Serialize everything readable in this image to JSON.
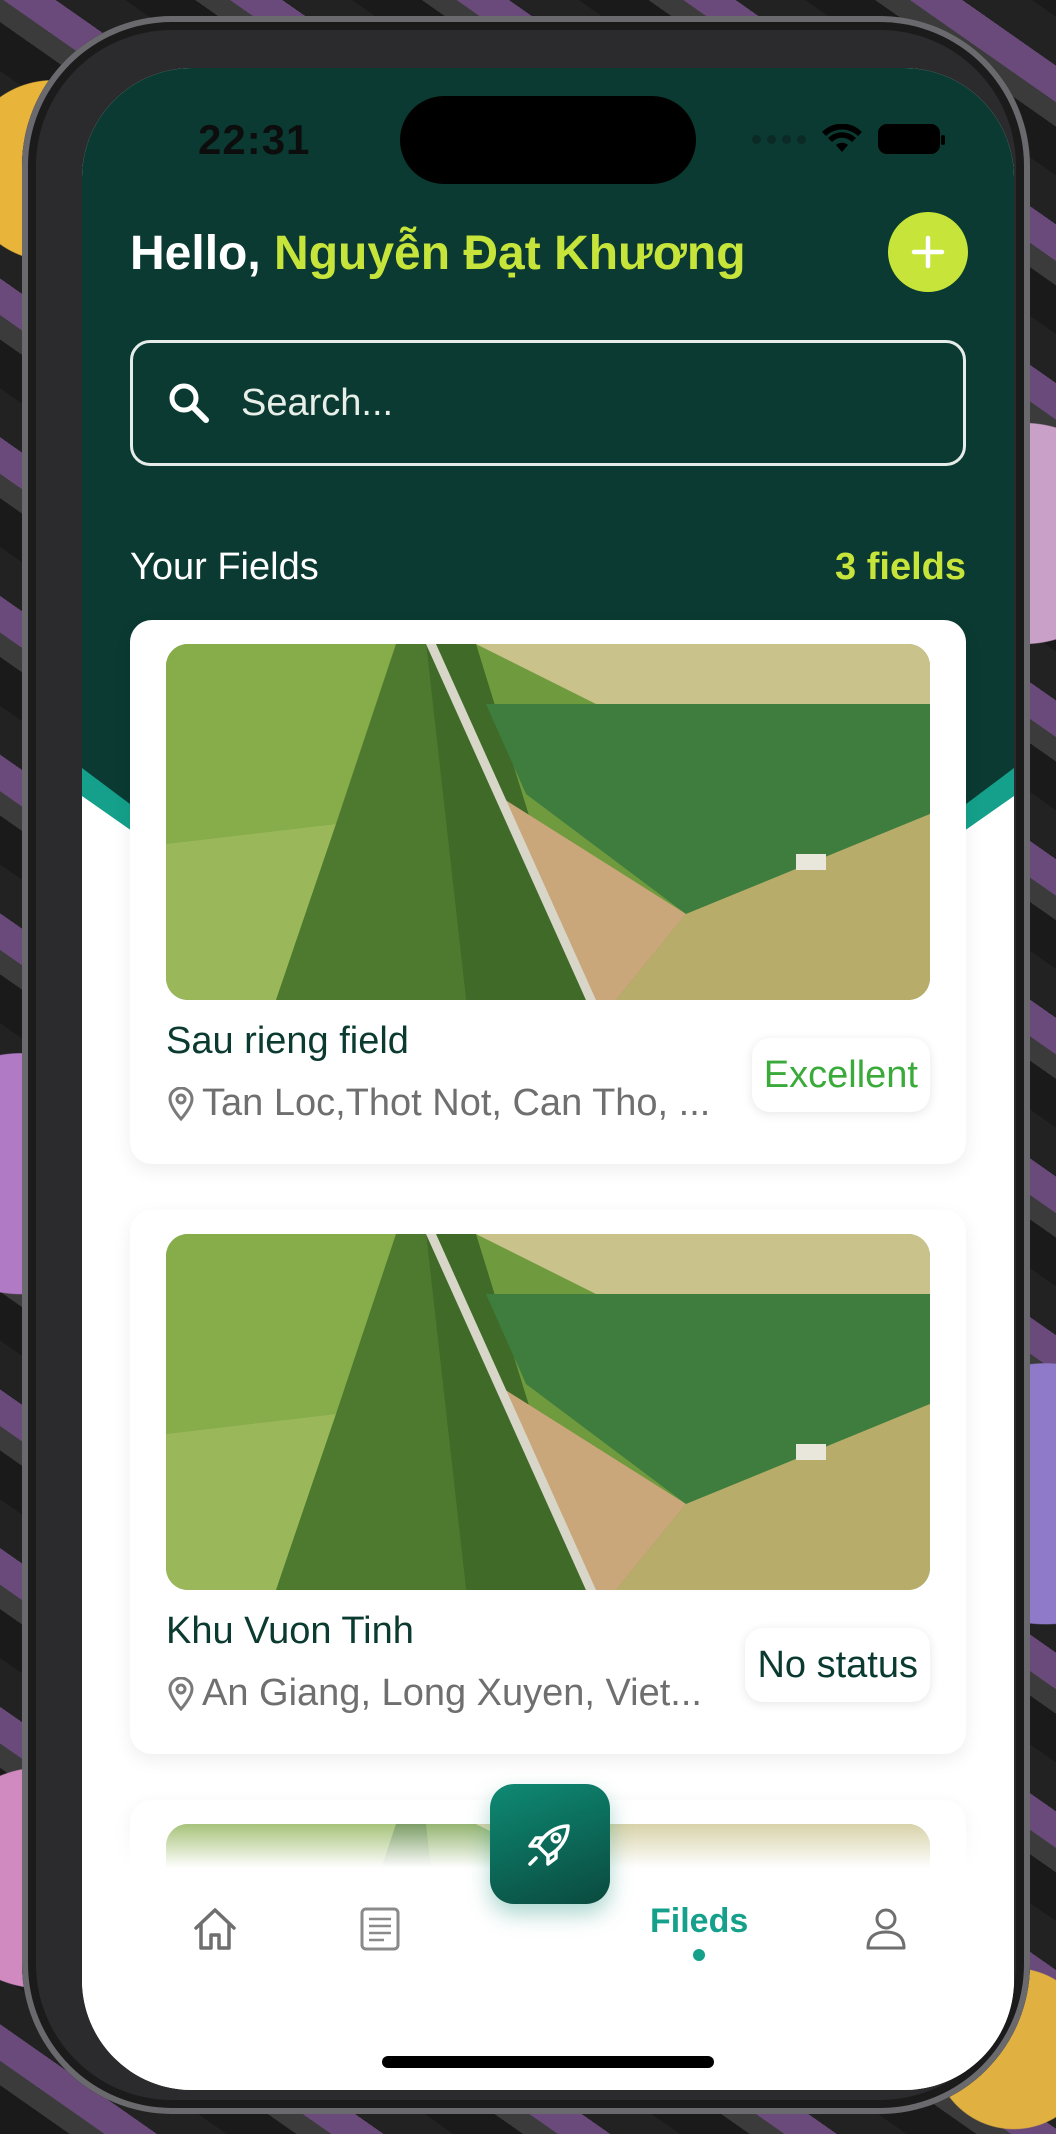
{
  "status_bar": {
    "time": "22:31"
  },
  "header": {
    "greeting_prefix": "Hello, ",
    "user_name": "Nguyễn Đạt Khương",
    "add_button_icon": "plus-icon"
  },
  "search": {
    "placeholder": "Search..."
  },
  "fields_section": {
    "title": "Your Fields",
    "count": "3 fields"
  },
  "fields": [
    {
      "name": "Sau rieng field",
      "location": "Tan Loc,Thot Not, Can Tho, ...",
      "status": "Excellent"
    },
    {
      "name": "Khu Vuon Tinh",
      "location": "An Giang, Long Xuyen, Viet...",
      "status": "No status"
    },
    {
      "name": "",
      "location": "",
      "status": ""
    }
  ],
  "tab_bar": {
    "items": [
      {
        "icon": "home-icon"
      },
      {
        "icon": "document-icon"
      },
      {
        "icon": "rocket-icon"
      },
      {
        "label": "Fileds",
        "active": true
      },
      {
        "icon": "user-icon"
      }
    ]
  },
  "colors": {
    "header_bg": "#0a3a32",
    "accent_lime": "#c6e43a",
    "accent_teal": "#14a08a",
    "status_excellent": "#3aab3a"
  }
}
